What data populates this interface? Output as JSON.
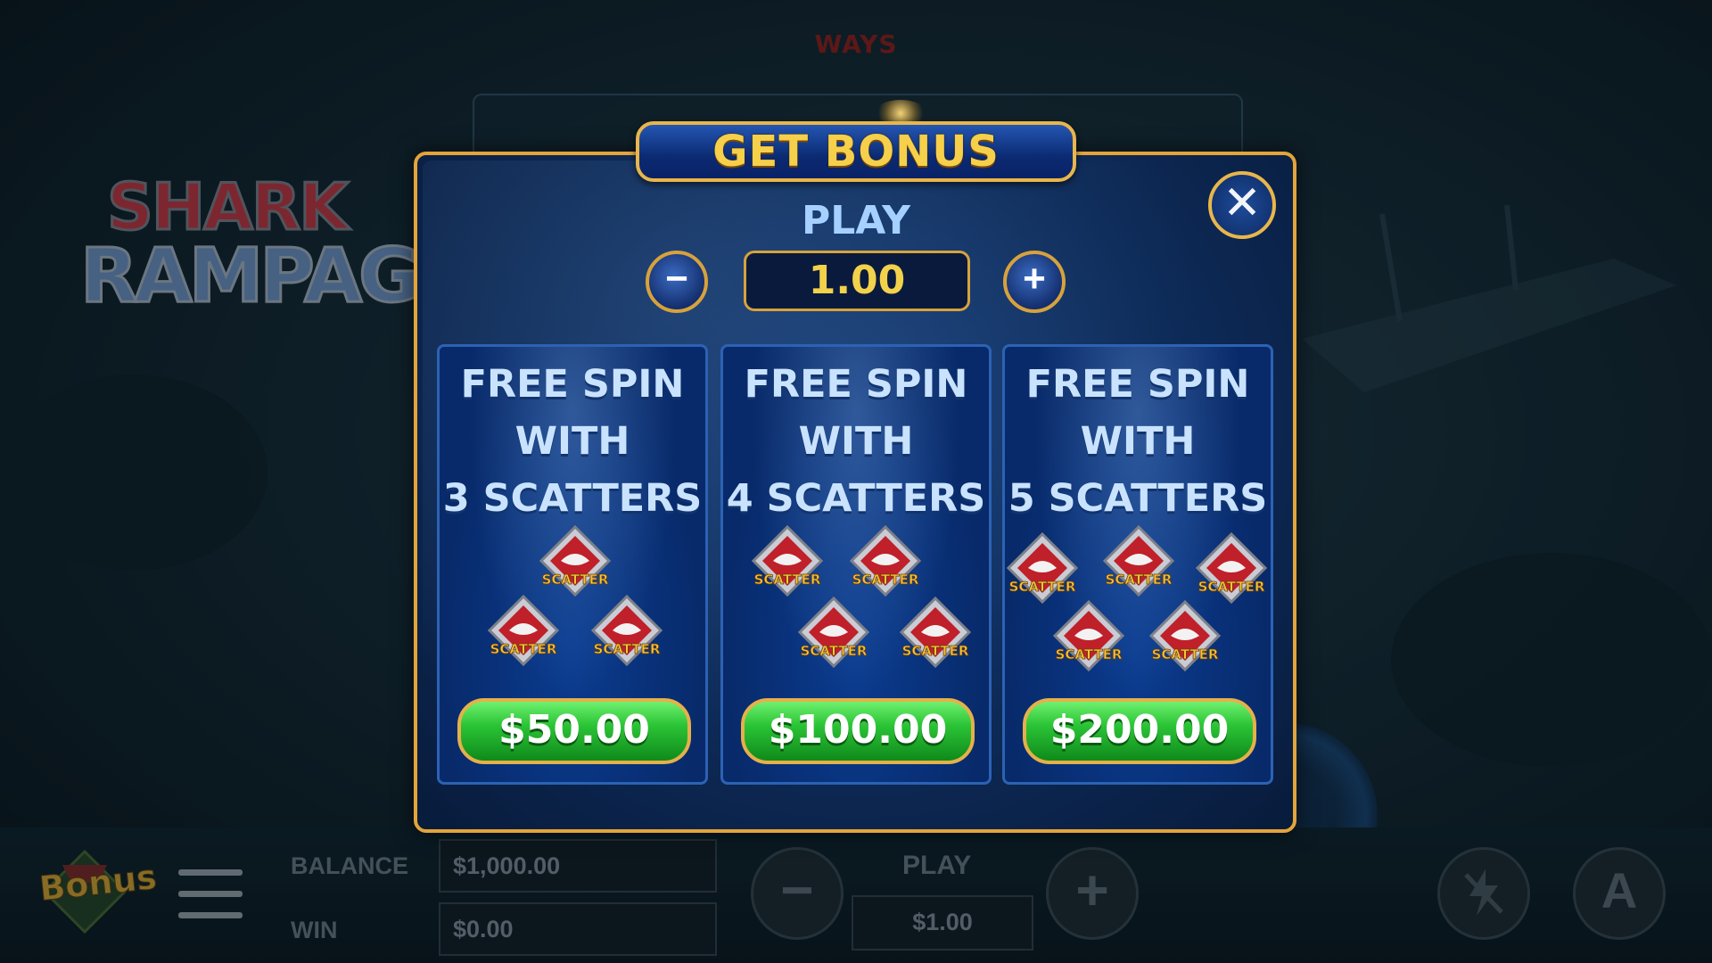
{
  "background": {
    "ways_label": "WAYS",
    "logo": {
      "line1": "SHARK",
      "line2": "RAMPAGE"
    }
  },
  "bottom_bar": {
    "bonus_logo_text": "Bonus",
    "balance_label": "BALANCE",
    "balance_value": "$1,000.00",
    "win_label": "WIN",
    "win_value": "$0.00",
    "play_label": "PLAY",
    "play_value": "$1.00",
    "minus_symbol": "−",
    "plus_symbol": "+",
    "auto_label": "A"
  },
  "modal": {
    "title": "GET BONUS",
    "play_label": "PLAY",
    "play_value": "1.00",
    "minus_symbol": "−",
    "plus_symbol": "+",
    "close_symbol": "✕",
    "scatter_word": "SCATTER",
    "options": [
      {
        "line1": "FREE SPIN",
        "line2": "WITH",
        "line3": "3  SCATTERS",
        "price": "$50.00",
        "scatter_count": 3
      },
      {
        "line1": "FREE SPIN",
        "line2": "WITH",
        "line3": "4  SCATTERS",
        "price": "$100.00",
        "scatter_count": 4
      },
      {
        "line1": "FREE SPIN",
        "line2": "WITH",
        "line3": "5  SCATTERS",
        "price": "$200.00",
        "scatter_count": 5
      }
    ]
  },
  "colors": {
    "accent_gold": "#e3a43a",
    "title_yellow": "#f6d04a",
    "price_green": "#2bc436",
    "modal_blue": "#0d2a57"
  }
}
